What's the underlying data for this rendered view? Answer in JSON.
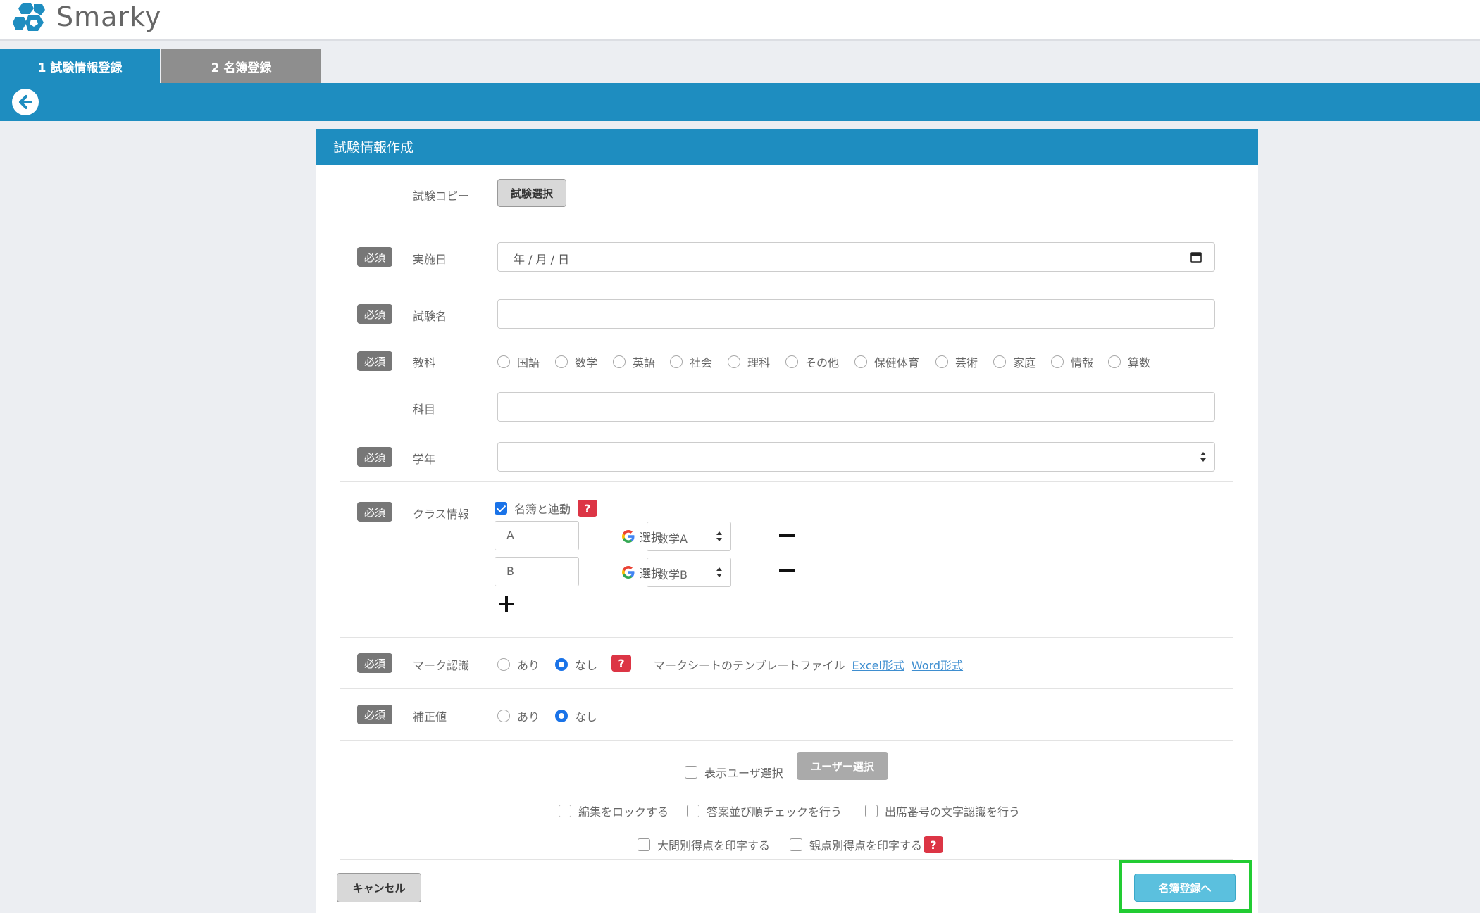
{
  "app": {
    "name": "Smarky"
  },
  "tabs": [
    {
      "label": "1  試験情報登録",
      "active": true
    },
    {
      "label": "2  名簿登録",
      "active": false
    }
  ],
  "card": {
    "title": "試験情報作成"
  },
  "exam_copy": {
    "label": "試験コピー",
    "button": "試験選択"
  },
  "required_badge": "必須",
  "date_row": {
    "label": "実施日",
    "placeholder": "年 / 月 / 日"
  },
  "exam_name_row": {
    "label": "試験名",
    "value": ""
  },
  "subject_row": {
    "label": "教科",
    "options": [
      "国語",
      "数学",
      "英語",
      "社会",
      "理科",
      "その他",
      "保健体育",
      "芸術",
      "家庭",
      "情報",
      "算数"
    ]
  },
  "course_row": {
    "label": "科目",
    "value": ""
  },
  "grade_row": {
    "label": "学年",
    "value": ""
  },
  "class_row": {
    "label": "クラス情報",
    "link_roster_label": "名簿と連動",
    "link_roster_checked": true,
    "help": "?",
    "select_label": "選択",
    "classes": [
      {
        "name": "A",
        "course": "数学A"
      },
      {
        "name": "B",
        "course": "数学B"
      }
    ]
  },
  "mark_row": {
    "label": "マーク認識",
    "options": [
      "あり",
      "なし"
    ],
    "selected": "なし",
    "help": "?",
    "template_text": "マークシートのテンプレートファイル",
    "excel_link": "Excel形式",
    "word_link": "Word形式"
  },
  "correction_row": {
    "label": "補正値",
    "options": [
      "あり",
      "なし"
    ],
    "selected": "なし"
  },
  "display_user": {
    "label": "表示ユーザ選択",
    "button": "ユーザー選択"
  },
  "options": {
    "lock_edit": "編集をロックする",
    "answer_order_check": "答案並び順チェックを行う",
    "attendance_ocr": "出席番号の文字認識を行う",
    "print_big_question": "大問別得点を印字する",
    "print_viewpoint": "観点別得点を印字する",
    "help": "?"
  },
  "footer": {
    "cancel": "キャンセル",
    "next": "名簿登録へ"
  },
  "colors": {
    "primary": "#1e8dc0",
    "next_button": "#5bc0de",
    "highlight": "#22cc33",
    "help": "#dc3545"
  }
}
